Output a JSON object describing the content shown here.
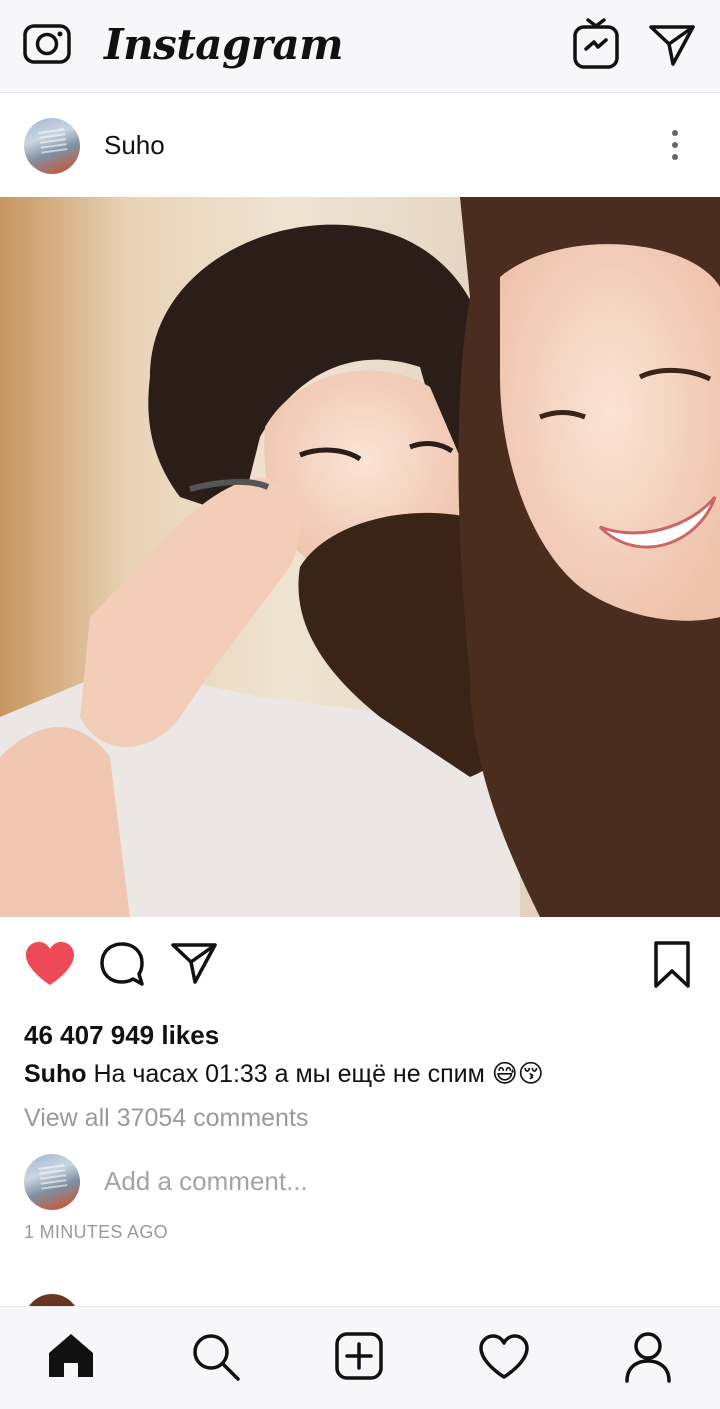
{
  "topbar": {
    "logo": "Instagram",
    "camera_icon": "camera-icon",
    "igtv_icon": "igtv-icon",
    "direct_icon": "paper-plane-icon"
  },
  "post": {
    "username": "Suho",
    "likes": "46 407 949 likes",
    "caption_user": "Suho",
    "caption_text": "На часах 01:33 а мы ещё не спим 😅😚",
    "view_all_comments": "View all 37054 comments",
    "add_comment_placeholder": "Add a comment...",
    "timestamp": "1 MINUTES AGO",
    "liked": true
  },
  "colors": {
    "like_red": "#ed4956",
    "icon": "#111111",
    "muted_text": "#9a9a9a",
    "bar_bg": "#f7f7f9"
  },
  "bottom_nav": [
    "home-icon",
    "search-icon",
    "add-post-icon",
    "activity-heart-icon",
    "profile-icon"
  ]
}
